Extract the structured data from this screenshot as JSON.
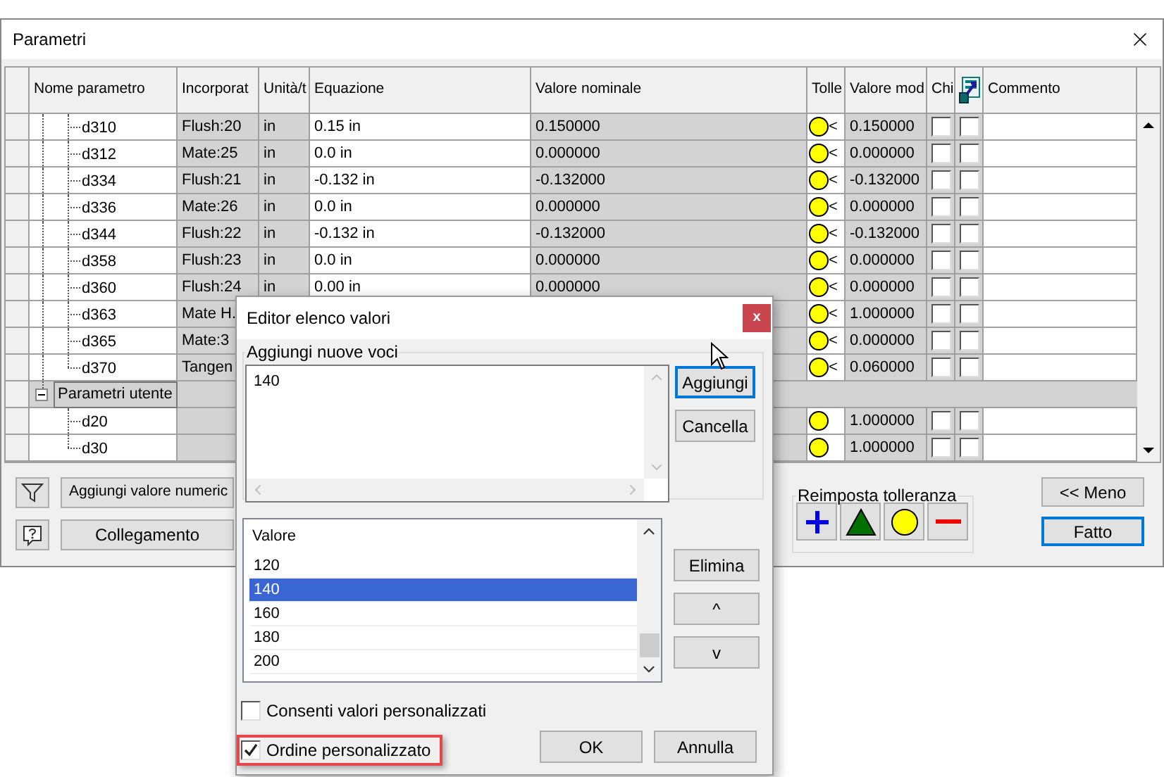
{
  "window": {
    "title": "Parametri"
  },
  "table": {
    "columns": [
      {
        "kind": "text",
        "label": "Nome parametro"
      },
      {
        "kind": "text",
        "label": "Incorporat"
      },
      {
        "kind": "text",
        "label": "Unità/t"
      },
      {
        "kind": "text",
        "label": "Equazione"
      },
      {
        "kind": "text",
        "label": "Valore nominale"
      },
      {
        "kind": "text",
        "label": "Tolle"
      },
      {
        "kind": "text",
        "label": "Valore mod"
      },
      {
        "kind": "text",
        "label": "Chi"
      },
      {
        "kind": "icon"
      },
      {
        "kind": "text",
        "label": "Commento"
      }
    ],
    "rows": [
      {
        "kind": "param",
        "name": "d310",
        "embedded": "Flush:20",
        "unit": "in",
        "equation": "0.15 in",
        "nominal": "0.150000",
        "tolerance_mark": "<",
        "modified": "0.150000",
        "chi_checked": false,
        "export_checked": false
      },
      {
        "kind": "param",
        "name": "d312",
        "embedded": "Mate:25",
        "unit": "in",
        "equation": "0.0 in",
        "nominal": "0.000000",
        "tolerance_mark": "<",
        "modified": "0.000000",
        "chi_checked": false,
        "export_checked": false
      },
      {
        "kind": "param",
        "name": "d334",
        "embedded": "Flush:21",
        "unit": "in",
        "equation": "-0.132 in",
        "nominal": "-0.132000",
        "tolerance_mark": "<",
        "modified": "-0.132000",
        "chi_checked": false,
        "export_checked": false
      },
      {
        "kind": "param",
        "name": "d336",
        "embedded": "Mate:26",
        "unit": "in",
        "equation": "0.0 in",
        "nominal": "0.000000",
        "tolerance_mark": "<",
        "modified": "0.000000",
        "chi_checked": false,
        "export_checked": false
      },
      {
        "kind": "param",
        "name": "d344",
        "embedded": "Flush:22",
        "unit": "in",
        "equation": "-0.132 in",
        "nominal": "-0.132000",
        "tolerance_mark": "<",
        "modified": "-0.132000",
        "chi_checked": false,
        "export_checked": false
      },
      {
        "kind": "param",
        "name": "d358",
        "embedded": "Flush:23",
        "unit": "in",
        "equation": "0.0 in",
        "nominal": "0.000000",
        "tolerance_mark": "<",
        "modified": "0.000000",
        "chi_checked": false,
        "export_checked": false
      },
      {
        "kind": "param",
        "name": "d360",
        "embedded": "Flush:24",
        "unit": "in",
        "equation": "0.00 in",
        "nominal": "0.000000",
        "tolerance_mark": "<",
        "modified": "0.000000",
        "chi_checked": false,
        "export_checked": false
      },
      {
        "kind": "param",
        "name": "d363",
        "embedded": "Mate H.",
        "tolerance_mark": "<",
        "modified": "1.000000",
        "chi_checked": false,
        "export_checked": false
      },
      {
        "kind": "param",
        "name": "d365",
        "embedded": "Mate:3",
        "tolerance_mark": "<",
        "modified": "0.000000",
        "chi_checked": false,
        "export_checked": false
      },
      {
        "kind": "param",
        "name": "d370",
        "embedded": "Tangen",
        "tolerance_mark": "<",
        "modified": "0.060000",
        "chi_checked": false,
        "export_checked": false
      },
      {
        "kind": "group",
        "name": "Parametri utente",
        "expanded": true,
        "children": [
          {
            "kind": "param",
            "name": "d20",
            "modified": "1.000000",
            "chi_checked": false,
            "export_checked": false
          },
          {
            "kind": "param",
            "name": "d30",
            "modified": "1.000000",
            "chi_checked": false,
            "export_checked": false
          }
        ]
      }
    ]
  },
  "footer": {
    "add_button": "Aggiungi valore numeric",
    "link_button": "Collegamento",
    "tolerance_group": "Reimposta tolleranza",
    "less_button": "<< Meno",
    "done_button": {
      "label": "Fatto",
      "focused": true
    }
  },
  "dialog": {
    "title": "Editor elenco valori",
    "close": "x",
    "new_entries": {
      "label": "Aggiungi nuove voci",
      "value": "140",
      "buttons": [
        {
          "label": "Aggiungi",
          "focused": true
        },
        {
          "label": "Cancella",
          "focused": false
        }
      ]
    },
    "list": {
      "header": "Valore",
      "items": [
        {
          "label": "120",
          "selected": false
        },
        {
          "label": "140",
          "selected": true
        },
        {
          "label": "160",
          "selected": false
        },
        {
          "label": "180",
          "selected": false
        },
        {
          "label": "200",
          "selected": false
        }
      ]
    },
    "list_buttons": [
      "Elimina",
      "^",
      "v"
    ],
    "options": [
      {
        "label": "Consenti valori personalizzati",
        "checked": false,
        "highlighted": false
      },
      {
        "label": "Ordine personalizzato",
        "checked": true,
        "highlighted": true
      }
    ],
    "buttons": [
      "OK",
      "Annulla"
    ]
  }
}
